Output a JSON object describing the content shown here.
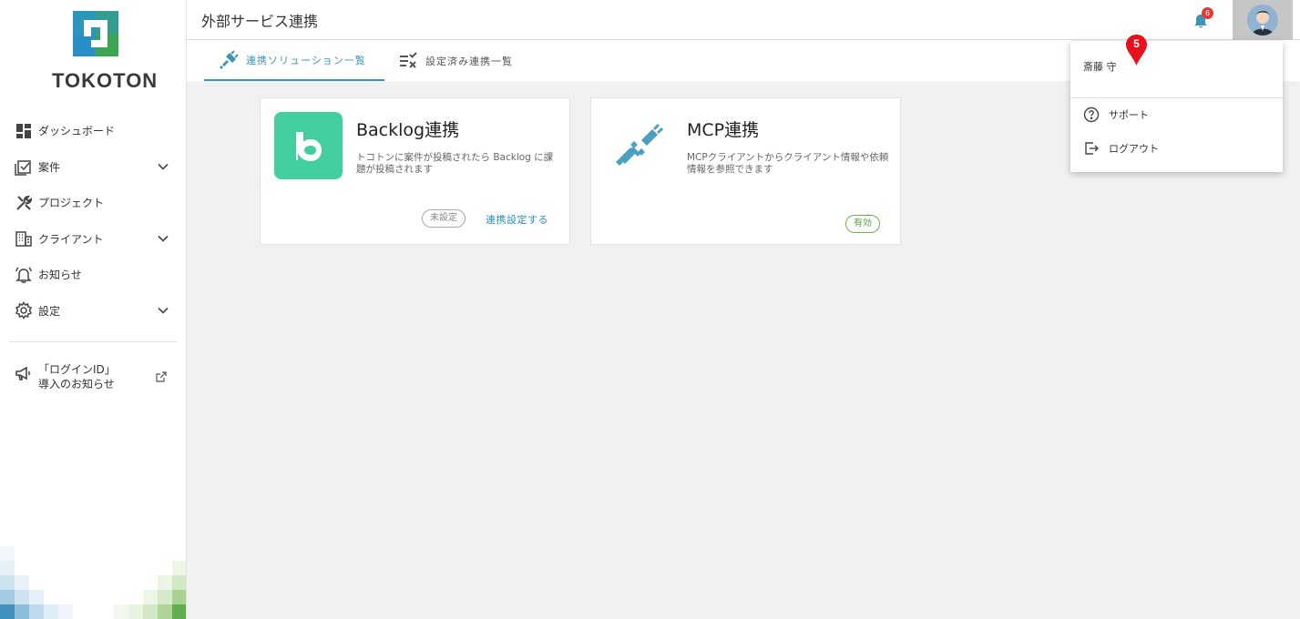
{
  "app": {
    "logo_text": "TOKOTON",
    "page_title": "外部サービス連携"
  },
  "sidebar": {
    "items": [
      {
        "label": "ダッシュボード",
        "icon": "dashboard-icon"
      },
      {
        "label": "案件",
        "icon": "case-icon",
        "expandable": true
      },
      {
        "label": "プロジェクト",
        "icon": "tools-icon"
      },
      {
        "label": "クライアント",
        "icon": "building-icon",
        "expandable": true
      },
      {
        "label": "お知らせ",
        "icon": "bell-outline-icon"
      },
      {
        "label": "設定",
        "icon": "gear-icon",
        "expandable": true
      }
    ],
    "extra": {
      "line1": "「ログインID」",
      "line2": "導入のお知らせ",
      "icon": "megaphone-icon"
    }
  },
  "header": {
    "notification_count": "6",
    "icons": [
      "bell-icon",
      "avatar"
    ]
  },
  "tabs": [
    {
      "label": "連携ソリューション一覧",
      "active": true,
      "icon": "plug-icon"
    },
    {
      "label": "設定済み連携一覧",
      "active": false,
      "icon": "checklist-icon"
    }
  ],
  "cards": [
    {
      "title": "Backlog連携",
      "description": "トコトンに案件が投稿されたら Backlog に課題が投稿されます",
      "status": "未設定",
      "action": "連携設定する",
      "icon": "backlog-logo-icon"
    },
    {
      "title": "MCP連携",
      "description": "MCPクライアントからクライアント情報や依頼情報を参照できます",
      "status": "有効",
      "icon": "plug-connect-icon"
    }
  ],
  "user_menu": {
    "user_name": "斎藤 守",
    "items": [
      {
        "label": "サポート",
        "icon": "help-circle-icon"
      },
      {
        "label": "ログアウト",
        "icon": "logout-icon"
      }
    ]
  },
  "annotation": {
    "marker": "5"
  },
  "colors": {
    "accent": "#3d94b5",
    "backlog_green": "#42ce9f",
    "active_green": "#6ab14b",
    "badge_red": "#e53935",
    "marker_red": "#e8101d"
  }
}
